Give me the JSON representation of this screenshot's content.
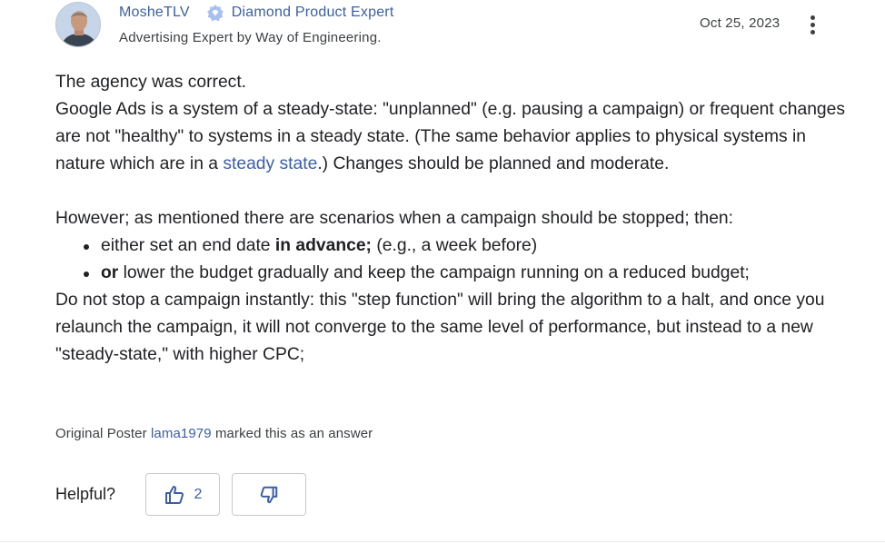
{
  "author": {
    "name": "MosheTLV",
    "badge": "Diamond Product Expert",
    "title": "Advertising Expert by Way of Engineering."
  },
  "post": {
    "date": "Oct 25, 2023",
    "p1": "The agency was correct.",
    "p2": "Google Ads is a system of a steady-state: \"unplanned\" (e.g. pausing a campaign)  or frequent changes are not \"healthy\" to systems in a steady state. (The same behavior applies to physical systems in nature which are in a ",
    "link": "steady state",
    "p2_end": ".) Changes should be planned and moderate.",
    "p3": "However; as mentioned there are scenarios when a campaign should be stopped; then:",
    "bullet1_pre": "either set an end date ",
    "bullet1_bold": "in advance;",
    "bullet1_post": " (e.g., a week before)",
    "bullet2_bold": "or",
    "bullet2_post": " lower the budget gradually and keep the campaign running on a reduced budget;",
    "p4": "Do not stop a campaign instantly: this \"step function\" will bring the algorithm to a halt, and once you relaunch the campaign, it will not converge to the same level of performance, but instead to a new \"steady-state,\" with higher CPC;"
  },
  "answer_note": {
    "prefix": "Original Poster ",
    "user": "lama1979",
    "suffix": " marked this as an answer"
  },
  "helpful": {
    "label": "Helpful?",
    "up_count": "2"
  },
  "colors": {
    "link": "#3c5fa8",
    "text": "#202124",
    "border": "#c7c9cc"
  }
}
